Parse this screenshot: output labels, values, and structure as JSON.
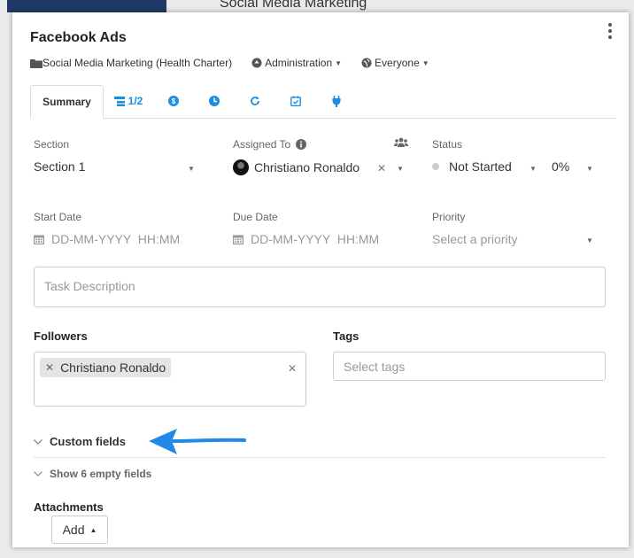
{
  "background": {
    "title": "Social Media Marketing"
  },
  "task": {
    "title": "Facebook Ads",
    "project": "Social Media Marketing (Health Charter)",
    "admin_label": "Administration",
    "visibility_label": "Everyone"
  },
  "tabs": {
    "summary": "Summary",
    "subtasks": "1/2"
  },
  "fields": {
    "section_label": "Section",
    "section_value": "Section 1",
    "assigned_label": "Assigned To",
    "assigned_value": "Christiano Ronaldo",
    "status_label": "Status",
    "status_value": "Not Started",
    "progress_value": "0%",
    "start_label": "Start Date",
    "start_placeholder": "DD-MM-YYYY  HH:MM",
    "due_label": "Due Date",
    "due_placeholder": "DD-MM-YYYY  HH:MM",
    "priority_label": "Priority",
    "priority_placeholder": "Select a priority",
    "description_placeholder": "Task Description"
  },
  "followers": {
    "label": "Followers",
    "chip": "Christiano Ronaldo"
  },
  "tags": {
    "label": "Tags",
    "placeholder": "Select tags"
  },
  "custom_fields": {
    "label": "Custom fields",
    "empty_label": "Show 6 empty fields"
  },
  "attachments": {
    "label": "Attachments",
    "add_label": "Add"
  },
  "icons": {
    "folder": "folder-icon",
    "admin": "admin-circle-icon",
    "globe": "globe-icon",
    "info": "info-icon",
    "team": "team-icon",
    "calendar": "calendar-icon",
    "arrow": "blue-arrow-annotation"
  },
  "colors": {
    "accent": "#1a8fe0",
    "arrow": "#2389e8"
  }
}
